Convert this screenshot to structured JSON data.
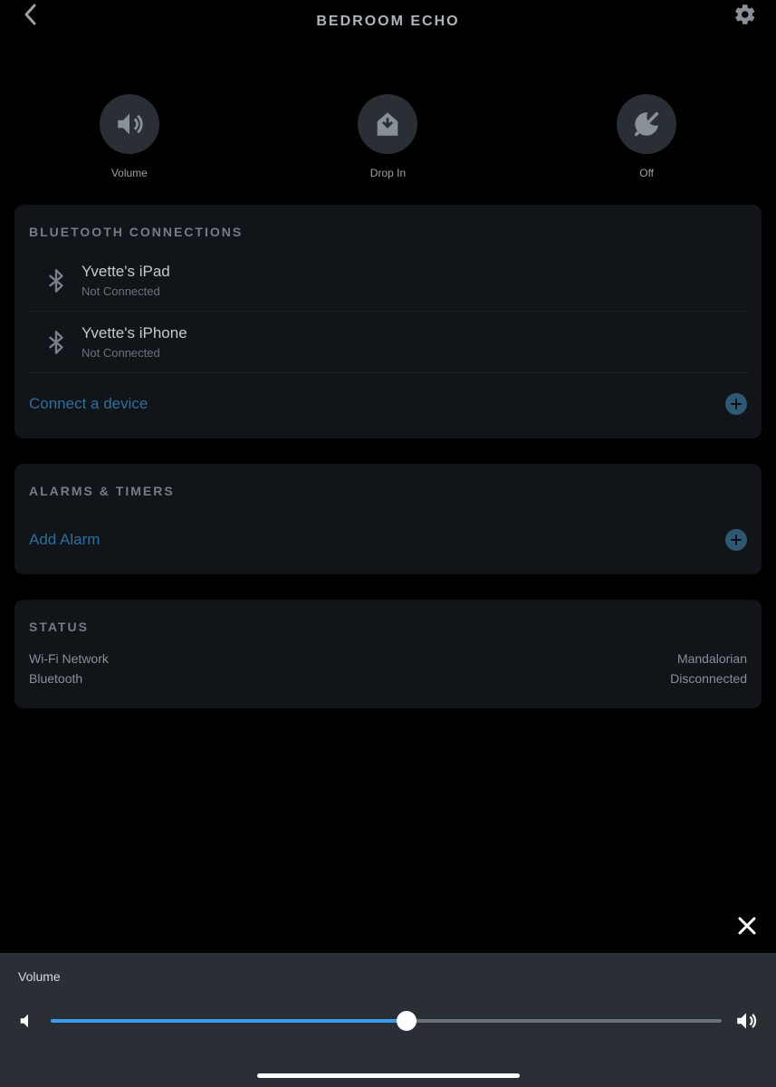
{
  "header": {
    "title": "BEDROOM ECHO"
  },
  "quick": {
    "volume": "Volume",
    "dropin": "Drop In",
    "dnd": "Off"
  },
  "bluetooth": {
    "section_title": "BLUETOOTH CONNECTIONS",
    "devices": [
      {
        "name": "Yvette's iPad",
        "status": "Not Connected"
      },
      {
        "name": "Yvette's iPhone",
        "status": "Not Connected"
      }
    ],
    "connect_label": "Connect a device"
  },
  "alarms": {
    "section_title": "ALARMS & TIMERS",
    "add_label": "Add Alarm"
  },
  "status": {
    "section_title": "STATUS",
    "rows": [
      {
        "label": "Wi-Fi Network",
        "value": "Mandalorian"
      },
      {
        "label": "Bluetooth",
        "value": "Disconnected"
      }
    ]
  },
  "volume_panel": {
    "title": "Volume",
    "percent": 53
  }
}
